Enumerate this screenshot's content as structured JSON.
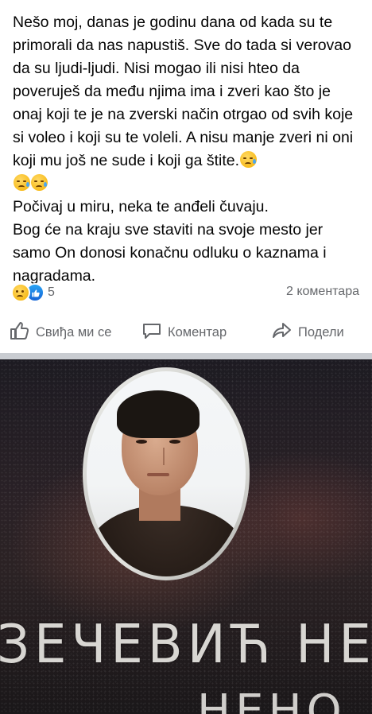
{
  "post": {
    "paragraph1": "Nešo moj, danas je godinu dana od kada su te primorali da nas napustiš. Sve do tada si verovao da su ljudi-ljudi. Nisi mogao ili nisi hteo da poveruješ da među njima ima i zveri kao što je onaj koji te je na zverski način otrgao od svih koje si voleo i koji su te voleli. A nisu manje zveri ni oni koji mu još ne sude i koji ga štite.",
    "paragraph2": "Počivaj u miru, neka te anđeli čuvaju.",
    "paragraph3": "Bog će na kraju sve staviti na svoje mesto jer samo On donosi konačnu odluku o kaznama i nagradama.",
    "emoji_icon": "sad-tear-emoji"
  },
  "reactions": {
    "count": "5",
    "comments": "2 коментара"
  },
  "actions": {
    "like_label": "Свиђа ми се",
    "comment_label": "Коментар",
    "share_label": "Подели"
  },
  "photo": {
    "engraved_line1": "ЗЕЧЕВИЋ НЕ",
    "engraved_line2": "НЕНО"
  },
  "colors": {
    "text": "#050505",
    "secondary_text": "#65676b",
    "like_blue": "#1877f2",
    "divider": "#c9ccd1"
  }
}
